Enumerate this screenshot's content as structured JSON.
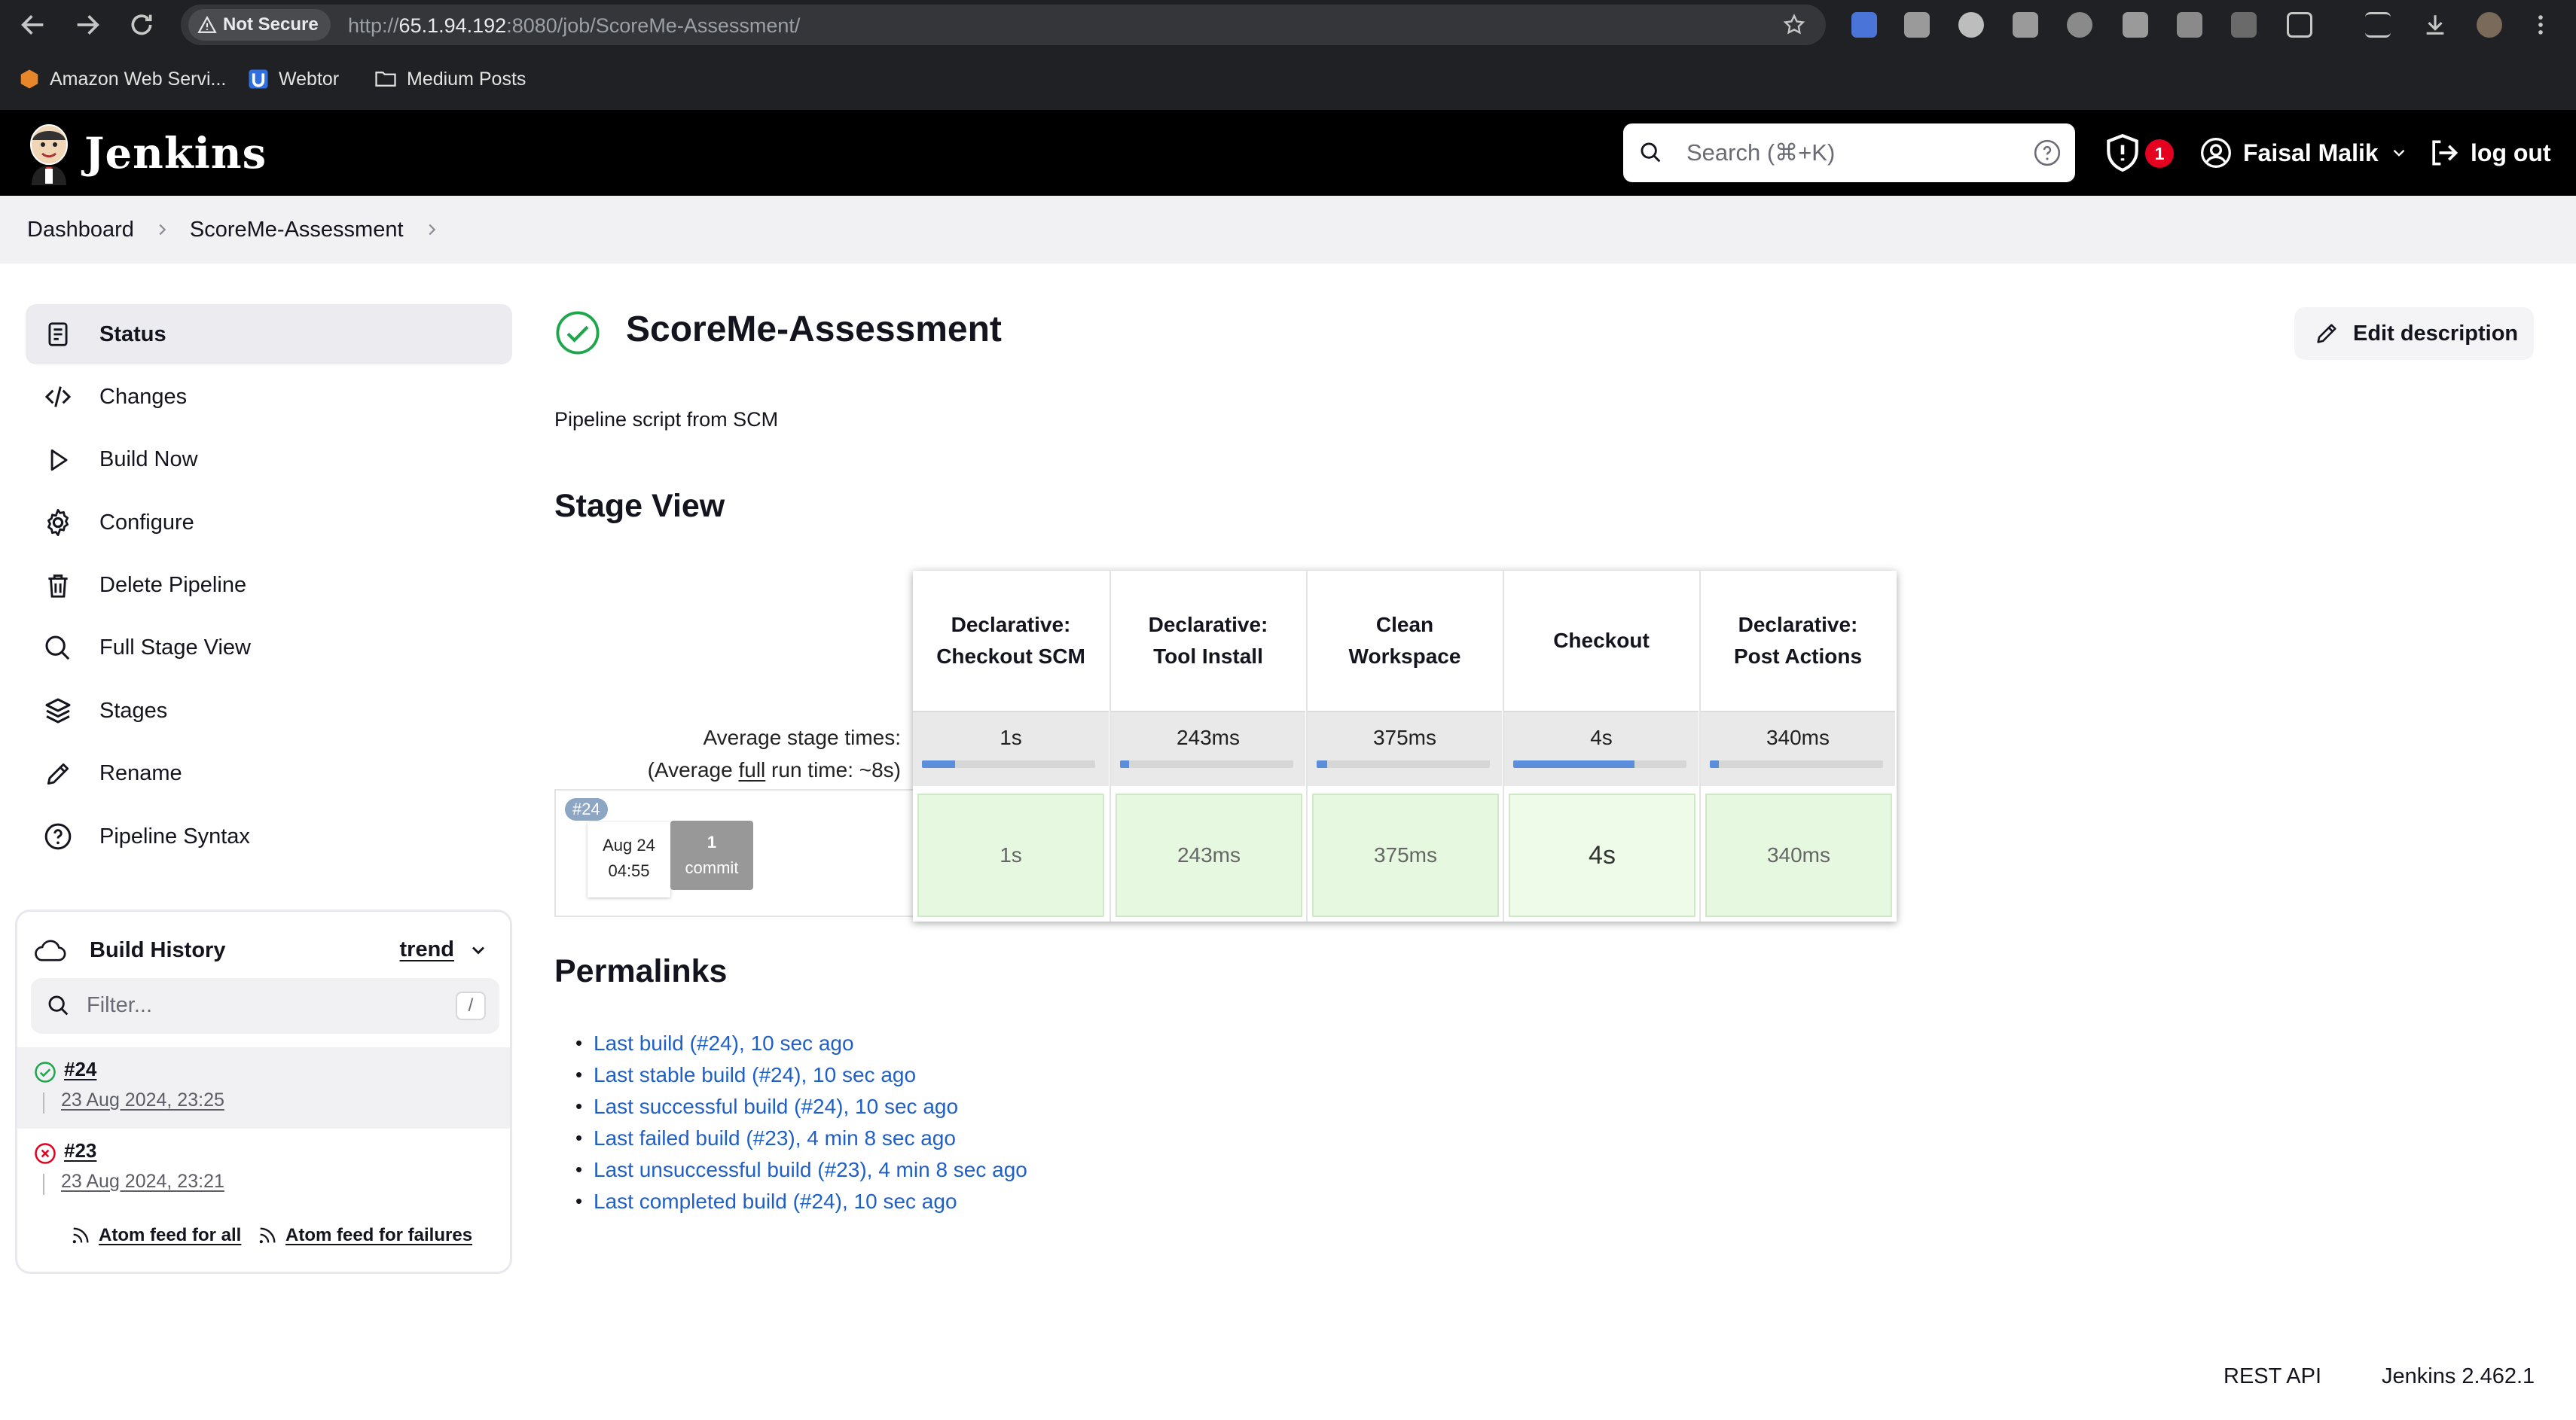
{
  "browser": {
    "security_label": "Not Secure",
    "url_prefix": "http://",
    "url_host": "65.1.94.192",
    "url_rest": ":8080/job/ScoreMe-Assessment/",
    "bookmarks": [
      "Amazon Web Servi...",
      "Webtor",
      "Medium Posts"
    ]
  },
  "header": {
    "app_name": "Jenkins",
    "search_placeholder": "Search (⌘+K)",
    "security_count": "1",
    "user_name": "Faisal Malik",
    "logout_label": "log out"
  },
  "breadcrumb": [
    "Dashboard",
    "ScoreMe-Assessment"
  ],
  "sidebar": {
    "items": [
      {
        "label": "Status",
        "icon": "status-doc-icon"
      },
      {
        "label": "Changes",
        "icon": "code-icon"
      },
      {
        "label": "Build Now",
        "icon": "play-icon"
      },
      {
        "label": "Configure",
        "icon": "gear-icon"
      },
      {
        "label": "Delete Pipeline",
        "icon": "trash-icon"
      },
      {
        "label": "Full Stage View",
        "icon": "search-icon"
      },
      {
        "label": "Stages",
        "icon": "layers-icon"
      },
      {
        "label": "Rename",
        "icon": "pencil-icon"
      },
      {
        "label": "Pipeline Syntax",
        "icon": "help-icon"
      }
    ]
  },
  "build_history": {
    "title": "Build History",
    "trend_label": "trend",
    "filter_placeholder": "Filter...",
    "filter_shortcut": "/",
    "builds": [
      {
        "number": "#24",
        "date": "23 Aug 2024, 23:25",
        "status": "success"
      },
      {
        "number": "#23",
        "date": "23 Aug 2024, 23:21",
        "status": "failed"
      }
    ],
    "atom_all": "Atom feed for all",
    "atom_failures": "Atom feed for failures"
  },
  "job": {
    "title": "ScoreMe-Assessment",
    "edit_description_label": "Edit description",
    "description": "Pipeline script from SCM"
  },
  "stage_view": {
    "title": "Stage View",
    "avg_label_line1": "Average stage times:",
    "avg_label_pre": "(Average ",
    "avg_label_link": "full",
    "avg_label_post": " run time: ~8s)",
    "run": {
      "badge": "#24",
      "date": "Aug 24",
      "time": "04:55",
      "commit_count": "1",
      "commit_label": "commit"
    },
    "stages": [
      {
        "name": "Declarative: Checkout SCM",
        "avg": "1s",
        "cell": "1s",
        "bar": 0.19
      },
      {
        "name": "Declarative: Tool Install",
        "avg": "243ms",
        "cell": "243ms",
        "bar": 0.05
      },
      {
        "name": "Clean Workspace",
        "avg": "375ms",
        "cell": "375ms",
        "bar": 0.06
      },
      {
        "name": "Checkout",
        "avg": "4s",
        "cell": "4s",
        "bar": 0.7
      },
      {
        "name": "Declarative: Post Actions",
        "avg": "340ms",
        "cell": "340ms",
        "bar": 0.05
      }
    ]
  },
  "permalinks": {
    "title": "Permalinks",
    "links": [
      "Last build (#24), 10 sec ago",
      "Last stable build (#24), 10 sec ago",
      "Last successful build (#24), 10 sec ago",
      "Last failed build (#23), 4 min 8 sec ago",
      "Last unsuccessful build (#23), 4 min 8 sec ago",
      "Last completed build (#24), 10 sec ago"
    ]
  },
  "footer": {
    "rest_api": "REST API",
    "version": "Jenkins 2.462.1"
  }
}
